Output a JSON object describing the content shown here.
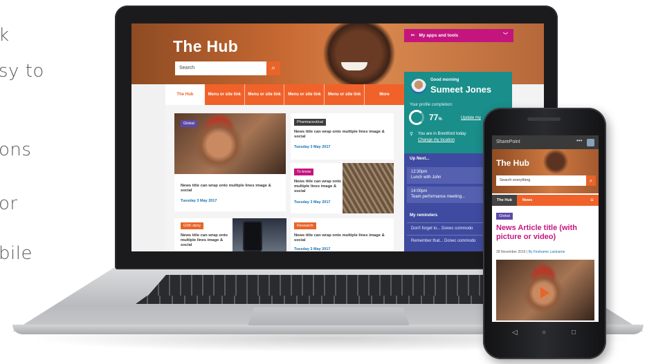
{
  "left_text": [
    "k",
    "sy to",
    "ons",
    "or",
    "bile"
  ],
  "hub": {
    "title": "The Hub",
    "search_placeholder": "Search",
    "apps_label": "My apps and tools",
    "nav": [
      "The Hub",
      "Menu or site link",
      "Menu or site link",
      "Menu or site link",
      "Menu or site link",
      "More"
    ]
  },
  "cards": [
    {
      "tag": "Global",
      "title": "News title can wrap onto multiple lines image & social",
      "date": "Tuesday 3 May 2017",
      "tag_color": "#5b49a8"
    },
    {
      "tag": "Pharmaceutical",
      "title": "News title can wrap onto multiple lines image & social",
      "date": "Tuesday 3 May 2017",
      "tag_color": "#3c3c3c"
    },
    {
      "tag": "To know",
      "title": "News title can wrap onto multiple lines image & social",
      "date": "Tuesday 3 May 2017",
      "tag_color": "#c4157f"
    },
    {
      "tag": "GSK story",
      "title": "News title can wrap onto multiple lines image & social",
      "date": "",
      "tag_color": "#e8642a"
    },
    {
      "tag": "Research",
      "title": "News title can wrap onto multiple lines image & social",
      "date": "Tuesday 3 May 2017",
      "tag_color": "#e8642a"
    }
  ],
  "panel": {
    "greeting": "Good morning",
    "name": "Sumeet Jones",
    "profile_label": "Your profile completion:",
    "profile_pct": "77",
    "profile_unit": "%",
    "update_link": "Update my",
    "location_text": "You are in Brentford today",
    "location_link": "Change my location",
    "up_next": "Up Next...",
    "events": [
      {
        "time": "12:30pm",
        "title": "Lunch with John"
      },
      {
        "time": "14:00pm",
        "title": "Team performance meeting..."
      }
    ],
    "reminders_heading": "My reminders",
    "reminders": [
      "Don't forget to... Donec commodo",
      "Remember that... Donec commodo"
    ]
  },
  "phone": {
    "app": "SharePoint",
    "menu_dots": "•••",
    "title": "The Hub",
    "search_placeholder": "Search everything",
    "nav_hub": "The Hub",
    "nav_news": "News",
    "tag": "Global",
    "article_title": "News Article title (with picture or video)",
    "date": "28 November 2016",
    "author": "By Firstname Lastname"
  },
  "colors": {
    "accent": "#e8642a",
    "magenta": "#c4157f",
    "teal": "#1a8e8a",
    "navy": "#3f4ba0"
  }
}
